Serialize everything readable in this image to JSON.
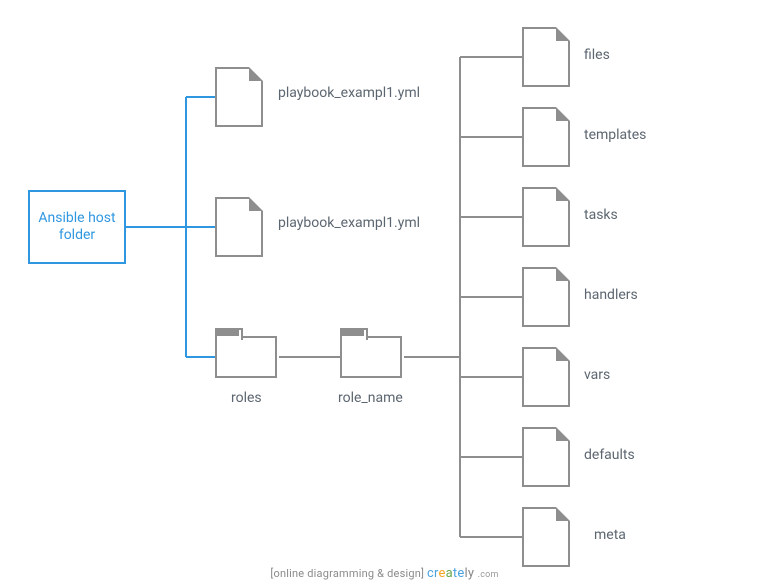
{
  "root": {
    "label": "Ansible host\nfolder"
  },
  "level1": {
    "playbook1": {
      "label": "playbook_exampl1.yml"
    },
    "playbook2": {
      "label": "playbook_exampl1.yml"
    },
    "roles": {
      "label": "roles"
    }
  },
  "level2": {
    "role_name": {
      "label": "role_name"
    }
  },
  "role_children": [
    {
      "key": "files",
      "label": "files"
    },
    {
      "key": "templates",
      "label": "templates"
    },
    {
      "key": "tasks",
      "label": "tasks"
    },
    {
      "key": "handlers",
      "label": "handlers"
    },
    {
      "key": "vars",
      "label": "vars"
    },
    {
      "key": "defaults",
      "label": "defaults"
    },
    {
      "key": "meta",
      "label": "meta"
    }
  ],
  "watermark": {
    "tagline": "[online diagramming & design]",
    "brand_letters": [
      "c",
      "r",
      "e",
      "a",
      "t",
      "e",
      "l",
      "y"
    ],
    "suffix": ".com"
  },
  "colors": {
    "accent": "#2f97e0",
    "line_gray": "#8e8e8e",
    "text": "#5c6670"
  }
}
